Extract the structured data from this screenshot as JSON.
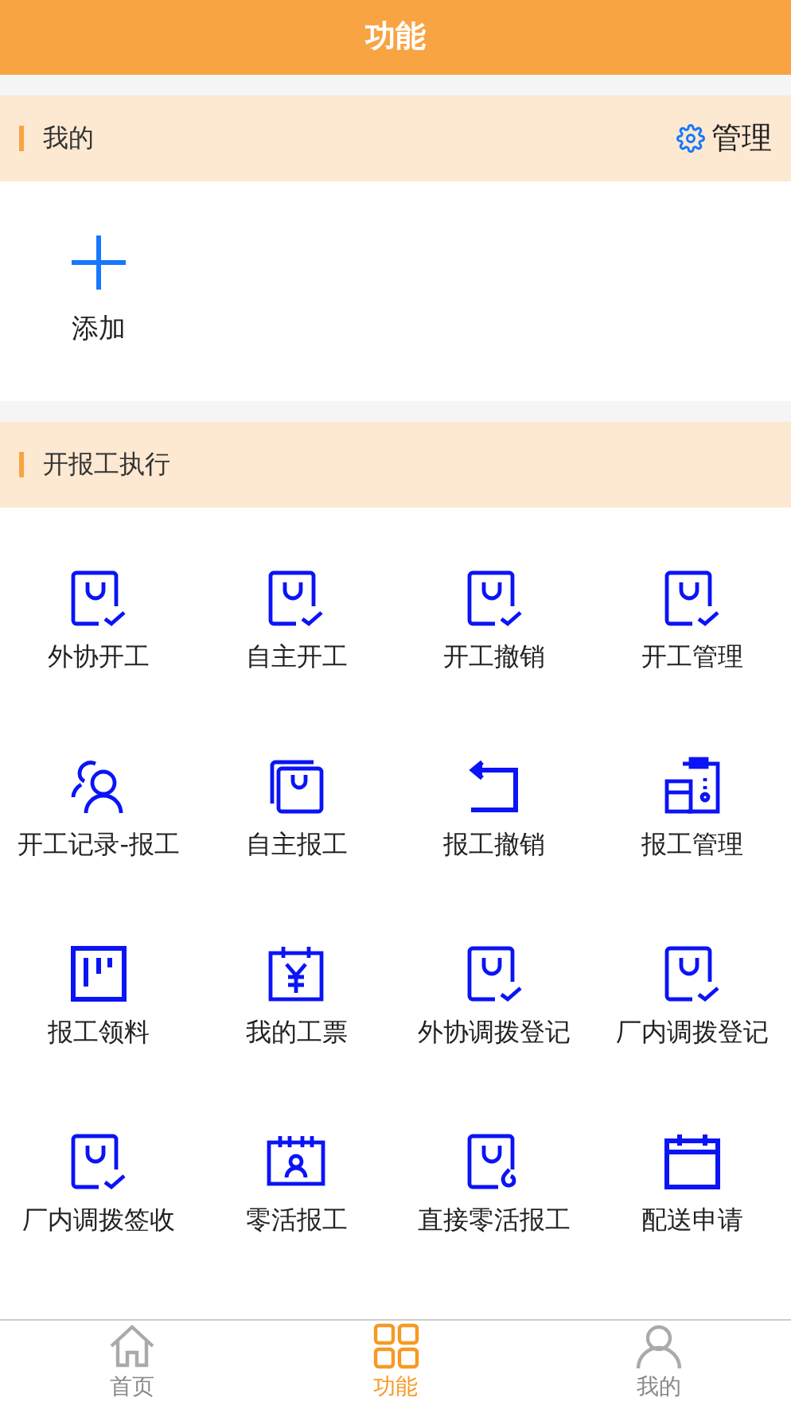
{
  "header": {
    "title": "功能"
  },
  "favorites": {
    "title": "我的",
    "manage": "管理",
    "items": [
      {
        "label": "添加"
      }
    ]
  },
  "section": {
    "title": "开报工执行",
    "items": [
      {
        "label": "外协开工",
        "kind": "bag-check"
      },
      {
        "label": "自主开工",
        "kind": "bag-check"
      },
      {
        "label": "开工撤销",
        "kind": "bag-check"
      },
      {
        "label": "开工管理",
        "kind": "bag-check"
      },
      {
        "label": "开工记录-报工",
        "kind": "people"
      },
      {
        "label": "自主报工",
        "kind": "bag-stack"
      },
      {
        "label": "报工撤销",
        "kind": "return"
      },
      {
        "label": "报工管理",
        "kind": "clipboard"
      },
      {
        "label": "报工领料",
        "kind": "board"
      },
      {
        "label": "我的工票",
        "kind": "calendar-yen"
      },
      {
        "label": "外协调拨登记",
        "kind": "bag-check"
      },
      {
        "label": "厂内调拨登记",
        "kind": "bag-check"
      },
      {
        "label": "厂内调拨签收",
        "kind": "bag-check"
      },
      {
        "label": "零活报工",
        "kind": "calendar-person"
      },
      {
        "label": "直接零活报工",
        "kind": "bag-fire"
      },
      {
        "label": "配送申请",
        "kind": "calendar"
      }
    ]
  },
  "tabbar": [
    {
      "label": "首页",
      "kind": "home",
      "selected": false
    },
    {
      "label": "功能",
      "kind": "grid",
      "selected": true
    },
    {
      "label": "我的",
      "kind": "person",
      "selected": false
    }
  ]
}
